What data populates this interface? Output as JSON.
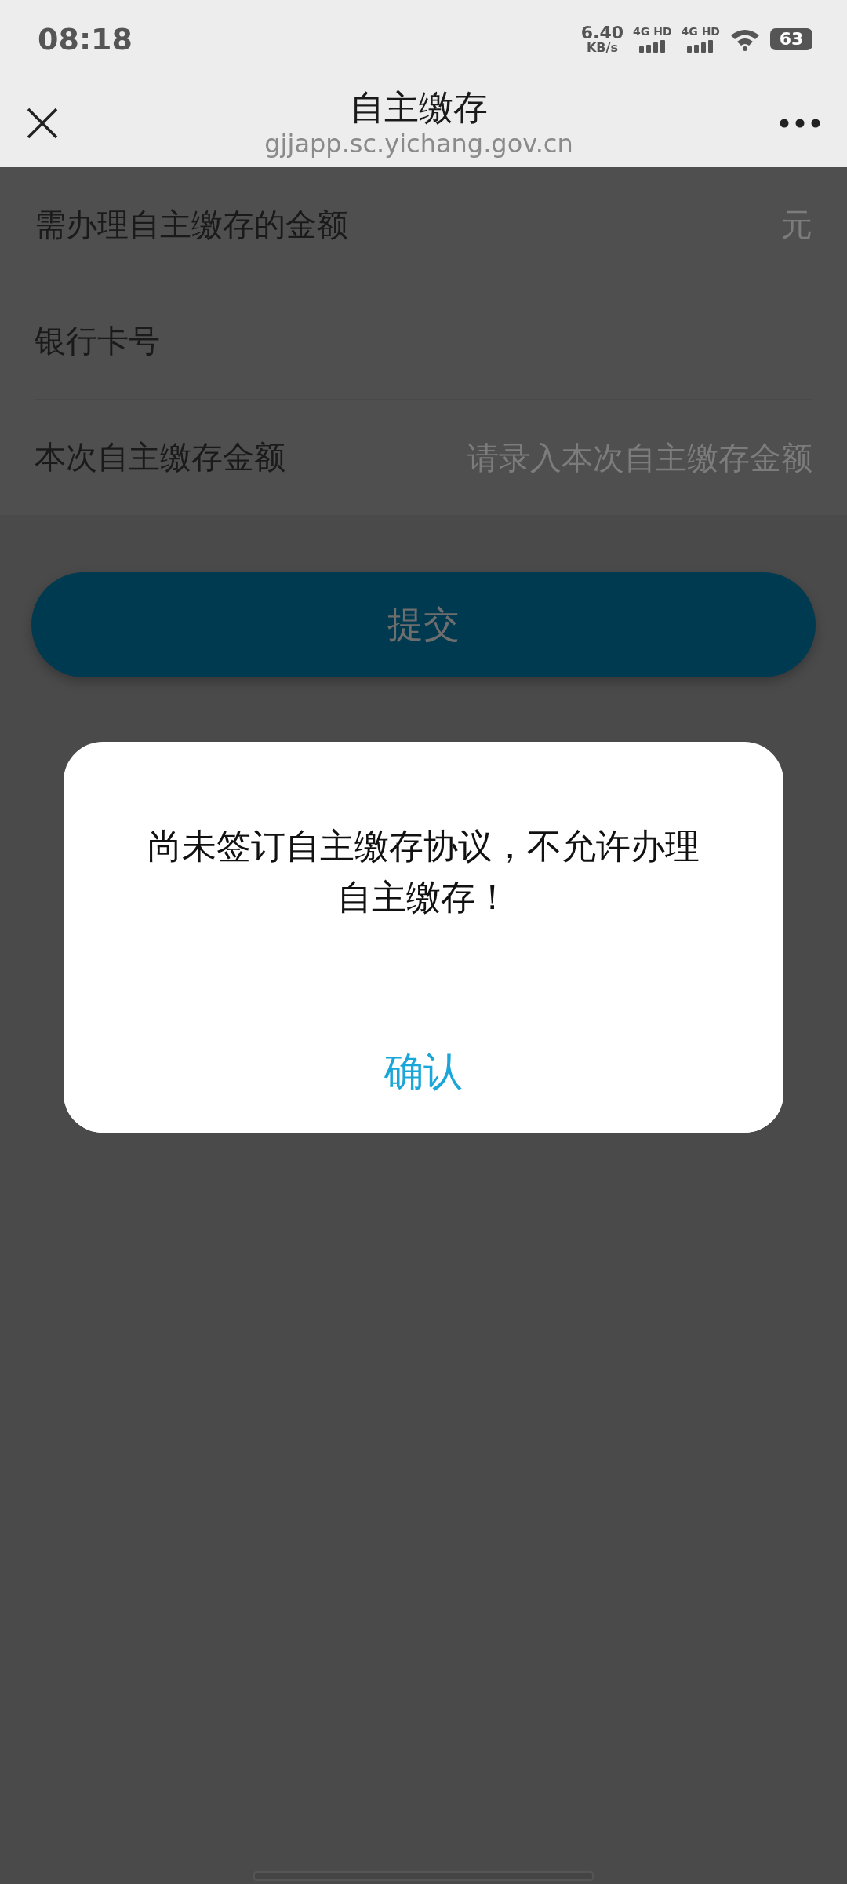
{
  "status_bar": {
    "time": "08:18",
    "net_speed": "6.40",
    "net_unit": "KB/s",
    "sims": [
      {
        "label": "4G HD"
      },
      {
        "label": "4G HD"
      }
    ],
    "battery": "63"
  },
  "header": {
    "title": "自主缴存",
    "url": "gjjapp.sc.yichang.gov.cn"
  },
  "form": {
    "rows": [
      {
        "label": "需办理自主缴存的金额",
        "unit": "元"
      },
      {
        "label": "银行卡号"
      },
      {
        "label": "本次自主缴存金额",
        "placeholder": "请录入本次自主缴存金额"
      }
    ]
  },
  "submit_button": "提交",
  "dialog": {
    "message": "尚未签订自主缴存协议，不允许办理自主缴存！",
    "confirm": "确认"
  }
}
